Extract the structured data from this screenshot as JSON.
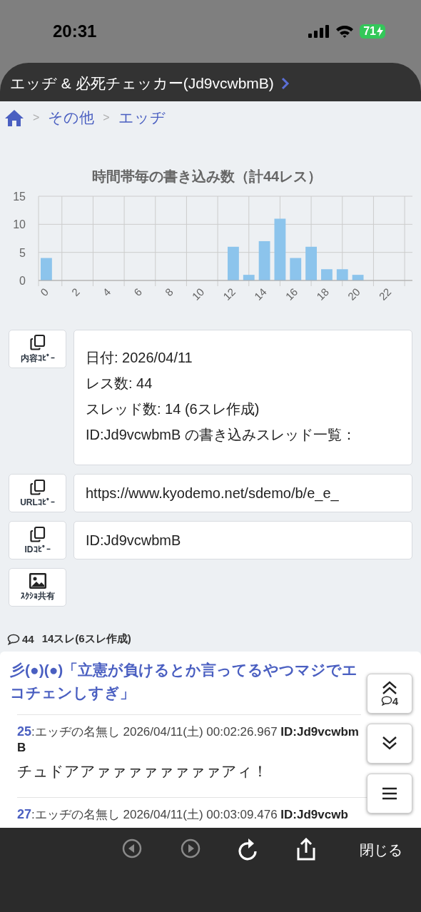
{
  "status_bar": {
    "time": "20:31",
    "battery": "71",
    "charging": true
  },
  "header": {
    "title": "エッヂ & 必死チェッカー(Jd9vcwbmB)"
  },
  "breadcrumb": [
    {
      "separator": ">",
      "label": "その他"
    },
    {
      "separator": ">",
      "label": "エッヂ"
    }
  ],
  "chart_data": {
    "type": "bar",
    "title": "時間帯毎の書き込み数（計44レス）",
    "x": [
      0,
      1,
      2,
      3,
      4,
      5,
      6,
      7,
      8,
      9,
      10,
      11,
      12,
      13,
      14,
      15,
      16,
      17,
      18,
      19,
      20,
      21,
      22,
      23
    ],
    "values": [
      4,
      0,
      0,
      0,
      0,
      0,
      0,
      0,
      0,
      0,
      0,
      0,
      6,
      1,
      7,
      11,
      4,
      6,
      2,
      2,
      1,
      0,
      0,
      0
    ],
    "ylim": [
      0,
      15
    ],
    "yticks": [
      0,
      5,
      10,
      15
    ],
    "xlim": [
      -0.5,
      23.5
    ],
    "xticks": [
      0,
      2,
      4,
      6,
      8,
      10,
      12,
      14,
      16,
      18,
      20,
      22
    ],
    "grid": true
  },
  "info_rows": [
    {
      "button": "内容ｺﾋﾟｰ",
      "kind": "copy",
      "lines": [
        "日付: 2026/04/11",
        "レス数: 44",
        "スレッド数: 14 (6スレ作成)",
        "ID:Jd9vcwbmB の書き込みスレッド一覧："
      ]
    },
    {
      "button": "URLｺﾋﾟｰ",
      "kind": "copy",
      "value": "https://www.kyodemo.net/sdemo/b/e_e_"
    },
    {
      "button": "IDｺﾋﾟｰ",
      "kind": "copy",
      "value": "ID:Jd9vcwbmB"
    },
    {
      "button": "ｽｸｼｮ共有",
      "kind": "screenshot"
    }
  ],
  "summary": {
    "count": "44",
    "text": "14スレ(6スレ作成)"
  },
  "threads": [
    {
      "title": "彡(●)(●)「立憲が負けるとか言ってるやつマジでエコチェンしすぎ」",
      "posts": [
        {
          "number": "25",
          "meta": ":エッヂの名無し 2026/04/11(土) 00:02:26.967",
          "id": "ID:Jd9vcwbmB",
          "body": "チュドアアァァァァァァァァアィ！"
        },
        {
          "number": "27",
          "meta": ":エッヂの名無し 2026/04/11(土) 00:03:09.476",
          "id": "ID:Jd9vcwb"
        }
      ]
    }
  ],
  "floating": [
    {
      "kind": "top",
      "count": "4"
    },
    {
      "kind": "bottom"
    },
    {
      "kind": "menu"
    }
  ],
  "toolbar": {
    "back_enabled": false,
    "forward_enabled": false,
    "close": "閉じる"
  }
}
